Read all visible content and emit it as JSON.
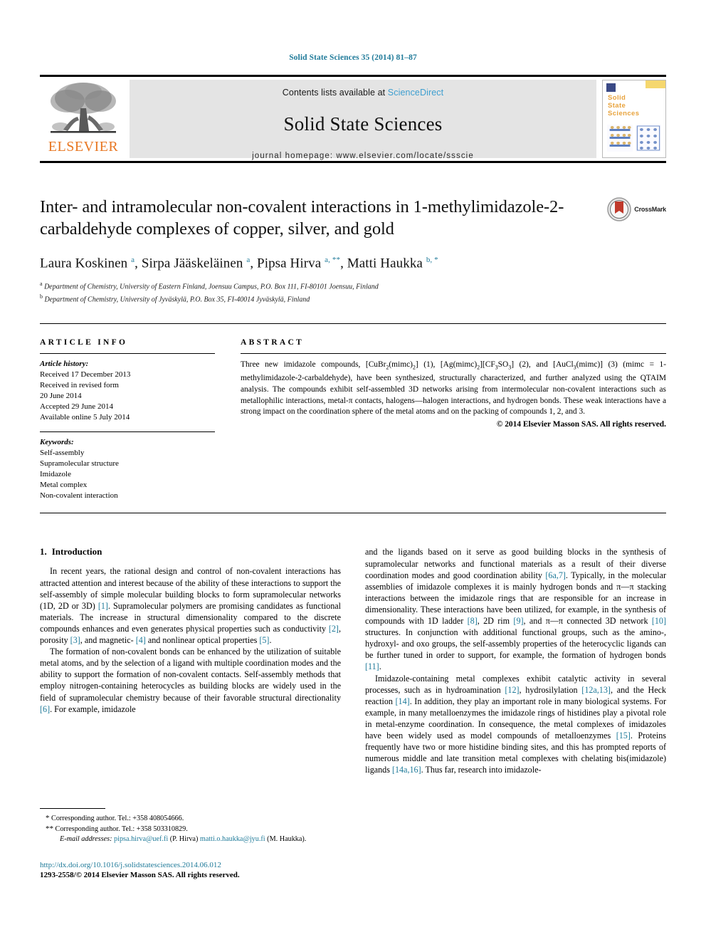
{
  "running_head": "Solid State Sciences 35 (2014) 81–87",
  "masthead": {
    "publisher_name": "ELSEVIER",
    "publisher_logo_alt": "elsevier-tree-logo",
    "contents_prefix": "Contents lists available at ",
    "sciencedirect_link": "ScienceDirect",
    "journal_name": "Solid State Sciences",
    "homepage_line": "journal homepage: www.elsevier.com/locate/ssscie",
    "cover": {
      "line1": "Solid",
      "line2": "State",
      "line3": "Sciences"
    }
  },
  "article": {
    "title": "Inter- and intramolecular non-covalent interactions in 1-methylimidazole-2-carbaldehyde complexes of copper, silver, and gold",
    "crossmark_label": "CrossMark",
    "authors_html": "Laura Koskinen <sup>a</sup>, Sirpa Jääskeläinen <sup>a</sup>, Pipsa Hirva <sup>a, **</sup>, Matti Haukka <sup>b, *</sup>",
    "affiliations": [
      "Department of Chemistry, University of Eastern Finland, Joensuu Campus, P.O. Box 111, FI-80101 Joensuu, Finland",
      "Department of Chemistry, University of Jyväskylä, P.O. Box 35, FI-40014 Jyväskylä, Finland"
    ],
    "affiliation_marks": [
      "a",
      "b"
    ]
  },
  "article_info": {
    "heading": "ARTICLE INFO",
    "history_label": "Article history:",
    "history": [
      "Received 17 December 2013",
      "Received in revised form",
      "20 June 2014",
      "Accepted 29 June 2014",
      "Available online 5 July 2014"
    ],
    "keywords_label": "Keywords:",
    "keywords": [
      "Self-assembly",
      "Supramolecular structure",
      "Imidazole",
      "Metal complex",
      "Non-covalent interaction"
    ]
  },
  "abstract": {
    "heading": "ABSTRACT",
    "text_html": "Three new imidazole compounds, [CuBr<sub>2</sub>(mimc)<sub>2</sub>] (1), [Ag(mimc)<sub>2</sub>][CF<sub>3</sub>SO<sub>3</sub>] (2), and [AuCl<sub>3</sub>(mimc)] (3) (mimc = 1-methylimidazole-2-carbaldehyde), have been synthesized, structurally characterized, and further analyzed using the QTAIM analysis. The compounds exhibit self-assembled 3D networks arising from intermolecular non-covalent interactions such as metallophilic interactions, metal-&#960; contacts, halogens&#8212;halogen interactions, and hydrogen bonds. These weak interactions have a strong impact on the coordination sphere of the metal atoms and on the packing of compounds 1, 2, and 3.",
    "copyright": "© 2014 Elsevier Masson SAS. All rights reserved."
  },
  "body": {
    "section_number": "1.",
    "section_title": "Introduction",
    "left_paragraphs_html": [
      "In recent years, the rational design and control of non-covalent interactions has attracted attention and interest because of the ability of these interactions to support the self-assembly of simple molecular building blocks to form supramolecular networks (1D, 2D or 3D) <span class=\"ref\">[1]</span>. Supramolecular polymers are promising candidates as functional materials. The increase in structural dimensionality compared to the discrete compounds enhances and even generates physical properties such as conductivity <span class=\"ref\">[2]</span>, porosity <span class=\"ref\">[3]</span>, and magnetic- <span class=\"ref\">[4]</span> and nonlinear optical properties <span class=\"ref\">[5]</span>.",
      "The formation of non-covalent bonds can be enhanced by the utilization of suitable metal atoms, and by the selection of a ligand with multiple coordination modes and the ability to support the formation of non-covalent contacts. Self-assembly methods that employ nitrogen-containing heterocycles as building blocks are widely used in the field of supramolecular chemistry because of their favorable structural directionality <span class=\"ref\">[6]</span>. For example, imidazole"
    ],
    "right_paragraphs_html": [
      "and the ligands based on it serve as good building blocks in the synthesis of supramolecular networks and functional materials as a result of their diverse coordination modes and good coordination ability <span class=\"ref\">[6a,7]</span>. Typically, in the molecular assemblies of imidazole complexes it is mainly hydrogen bonds and &#960;&#8212;&#960; stacking interactions between the imidazole rings that are responsible for an increase in dimensionality. These interactions have been utilized, for example, in the synthesis of compounds with 1D ladder <span class=\"ref\">[8]</span>, 2D rim <span class=\"ref\">[9]</span>, and &#960;&#8212;&#960; connected 3D network <span class=\"ref\">[10]</span> structures. In conjunction with additional functional groups, such as the amino-, hydroxyl- and oxo groups, the self-assembly properties of the heterocyclic ligands can be further tuned in order to support, for example, the formation of hydrogen bonds <span class=\"ref\">[11]</span>.",
      "Imidazole-containing metal complexes exhibit catalytic activity in several processes, such as in hydroamination <span class=\"ref\">[12]</span>, hydrosilylation <span class=\"ref\">[12a,13]</span>, and the Heck reaction <span class=\"ref\">[14]</span>. In addition, they play an important role in many biological systems. For example, in many metalloenzymes the imidazole rings of histidines play a pivotal role in metal-enzyme coordination. In consequence, the metal complexes of imidazoles have been widely used as model compounds of metalloenzymes <span class=\"ref\">[15]</span>. Proteins frequently have two or more histidine binding sites, and this has prompted reports of numerous middle and late transition metal complexes with chelating bis(imidazole) ligands <span class=\"ref\">[14a,16]</span>. Thus far, research into imidazole-"
    ]
  },
  "footnotes": {
    "corresponding_1": "Corresponding author. Tel.: +358 408054666.",
    "corresponding_1_mark": "*",
    "corresponding_2": "Corresponding author. Tel.: +358 503310829.",
    "corresponding_2_mark": "**",
    "email_label": "E-mail addresses:",
    "email_1": "pipsa.hirva@uef.fi",
    "email_1_owner": "(P. Hirva)",
    "email_2": "matti.o.haukka@jyu.fi",
    "email_2_owner": "(M. Haukka).",
    "doi": "http://dx.doi.org/10.1016/j.solidstatesciences.2014.06.012",
    "issn_line": "1293-2558/© 2014 Elsevier Masson SAS. All rights reserved."
  },
  "colors": {
    "link": "#1f7a99",
    "sciencedirect": "#3f9fd0",
    "elsevier_orange": "#e87722",
    "banner_gray": "#e4e4e4",
    "crossmark_red": "#c0392b"
  }
}
